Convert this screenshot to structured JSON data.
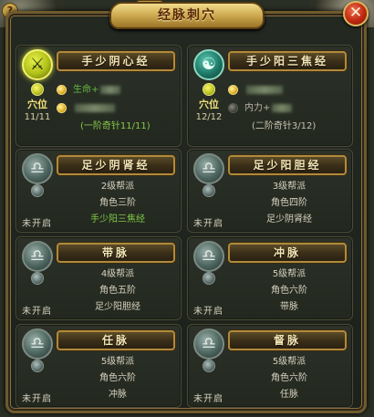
{
  "window": {
    "title": "经脉刺穴",
    "title_ornament": "•••",
    "help_label": "?",
    "close_label": "✕"
  },
  "meridians_open": [
    {
      "name": "手少阴心经",
      "medal_glyph": "⚔",
      "acupoint_label": "穴位",
      "acupoint_count": "11/11",
      "stat_label": "生命+",
      "progress": "(一阶奇针11/11)",
      "row1_dot": "gold",
      "row2_dot": "gold"
    },
    {
      "name": "手少阳三焦经",
      "medal_glyph": "☯",
      "acupoint_label": "穴位",
      "acupoint_count": "12/12",
      "stat_label": "内力+",
      "progress": "(二阶奇针3/12)",
      "row1_dot": "gold",
      "row2_dot": "dark"
    }
  ],
  "meridians_locked": [
    {
      "name": "足少阴肾经",
      "status": "未开启",
      "req_level": "2级帮派",
      "req_char": "角色三阶",
      "req_prev": "手少阳三焦经",
      "prev_met": true
    },
    {
      "name": "足少阳胆经",
      "status": "未开启",
      "req_level": "3级帮派",
      "req_char": "角色四阶",
      "req_prev": "足少阴肾经",
      "prev_met": false
    },
    {
      "name": "带脉",
      "status": "未开启",
      "req_level": "4级帮派",
      "req_char": "角色五阶",
      "req_prev": "足少阳胆经",
      "prev_met": false
    },
    {
      "name": "冲脉",
      "status": "未开启",
      "req_level": "5级帮派",
      "req_char": "角色六阶",
      "req_prev": "带脉",
      "prev_met": false
    },
    {
      "name": "任脉",
      "status": "未开启",
      "req_level": "5级帮派",
      "req_char": "角色六阶",
      "req_prev": "冲脉",
      "prev_met": false
    },
    {
      "name": "督脉",
      "status": "未开启",
      "req_level": "5级帮派",
      "req_char": "角色六阶",
      "req_prev": "任脉",
      "prev_met": false
    }
  ],
  "colors": {
    "accent_gold": "#c9a44a",
    "met_green": "#67b742",
    "close_red": "#c02810"
  }
}
